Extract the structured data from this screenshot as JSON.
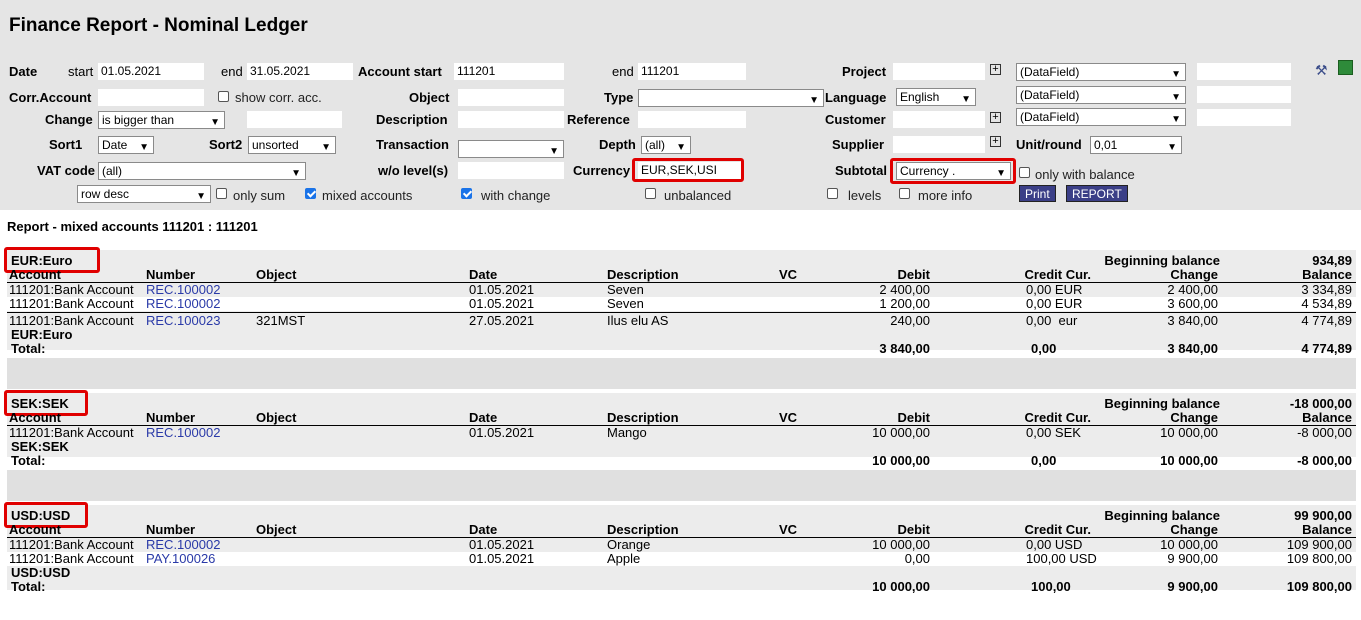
{
  "title": "Finance Report - Nominal Ledger",
  "filters": {
    "date_label": "Date",
    "date_start_label": "start",
    "date_start": "01.05.2021",
    "date_end_label": "end",
    "date_end": "31.05.2021",
    "account_start_label": "Account  start",
    "account_start": "111201",
    "account_end_label": "end",
    "account_end": "111201",
    "project_label": "Project",
    "corr_account_label": "Corr.Account",
    "show_corr_label": "show corr. acc.",
    "object_label": "Object",
    "type_label": "Type",
    "language_label": "Language",
    "language_value": "English",
    "change_label": "Change",
    "change_value": "is bigger than",
    "description_label": "Description",
    "reference_label": "Reference",
    "customer_label": "Customer",
    "sort1_label": "Sort1",
    "sort1_value": "Date",
    "sort2_label": "Sort2",
    "sort2_value": "unsorted",
    "transaction_label": "Transaction",
    "depth_label": "Depth",
    "depth_value": "(all)",
    "supplier_label": "Supplier",
    "unit_round_label": "Unit/round",
    "unit_round_value": "0,01",
    "vat_label": "VAT code",
    "vat_value": "(all)",
    "wo_level_label": "w/o level(s)",
    "currency_label": "Currency",
    "currency_value": "EUR,SEK,USI",
    "subtotal_label": "Subtotal",
    "subtotal_value": "Currency .",
    "only_balance_label": "only with balance",
    "rowdesc_value": "row desc",
    "only_sum_label": "only sum",
    "mixed_accounts_label": "mixed accounts",
    "with_change_label": "with change",
    "unbalanced_label": "unbalanced",
    "levels_label": "levels",
    "more_info_label": "more info",
    "datafield1": "(DataField)",
    "datafield2": "(DataField)",
    "datafield3": "(DataField)",
    "print_label": "Print",
    "report_label": "REPORT"
  },
  "report": {
    "header": "Report - mixed accounts 111201 : 111201",
    "columns": {
      "account": "Account",
      "number": "Number",
      "object": "Object",
      "date": "Date",
      "description": "Description",
      "vc": "VC",
      "debit": "Debit",
      "credit_cur": "Credit Cur.",
      "change": "Change",
      "balance": "Balance"
    },
    "beginning_label": "Beginning balance",
    "total_label": "Total:",
    "groups": [
      {
        "name": "EUR:Euro",
        "beginning": "934,89",
        "rows": [
          {
            "account": "111201:Bank Account",
            "number": "REC.100002",
            "object": "",
            "date": "01.05.2021",
            "description": "Seven",
            "debit": "2 400,00",
            "credit": "0,00 EUR",
            "change": "2 400,00",
            "balance": "3 334,89"
          },
          {
            "account": "111201:Bank Account",
            "number": "REC.100002",
            "object": "",
            "date": "01.05.2021",
            "description": "Seven",
            "debit": "1 200,00",
            "credit": "0,00 EUR",
            "change": "3 600,00",
            "balance": "4 534,89"
          },
          {
            "account": "111201:Bank Account",
            "number": "REC.100023",
            "object": "321MST",
            "date": "27.05.2021",
            "description": "Ilus elu AS",
            "debit": "240,00",
            "credit": "0,00  eur",
            "change": "3 840,00",
            "balance": "4 774,89"
          }
        ],
        "total": {
          "debit": "3 840,00",
          "credit": "0,00",
          "change": "3 840,00",
          "balance": "4 774,89"
        }
      },
      {
        "name": "SEK:SEK",
        "beginning": "-18 000,00",
        "rows": [
          {
            "account": "111201:Bank Account",
            "number": "REC.100002",
            "object": "",
            "date": "01.05.2021",
            "description": "Mango",
            "debit": "10 000,00",
            "credit": "0,00 SEK",
            "change": "10 000,00",
            "balance": "-8 000,00"
          }
        ],
        "total": {
          "debit": "10 000,00",
          "credit": "0,00",
          "change": "10 000,00",
          "balance": "-8 000,00"
        }
      },
      {
        "name": "USD:USD",
        "beginning": "99 900,00",
        "rows": [
          {
            "account": "111201:Bank Account",
            "number": "REC.100002",
            "object": "",
            "date": "01.05.2021",
            "description": "Orange",
            "debit": "10 000,00",
            "credit": "0,00 USD",
            "change": "10 000,00",
            "balance": "109 900,00"
          },
          {
            "account": "111201:Bank Account",
            "number": "PAY.100026",
            "object": "",
            "date": "01.05.2021",
            "description": "Apple",
            "debit": "0,00",
            "credit": "100,00 USD",
            "change": "9 900,00",
            "balance": "109 800,00"
          }
        ],
        "total": {
          "debit": "10 000,00",
          "credit": "100,00",
          "change": "9 900,00",
          "balance": "109 800,00"
        }
      }
    ]
  }
}
